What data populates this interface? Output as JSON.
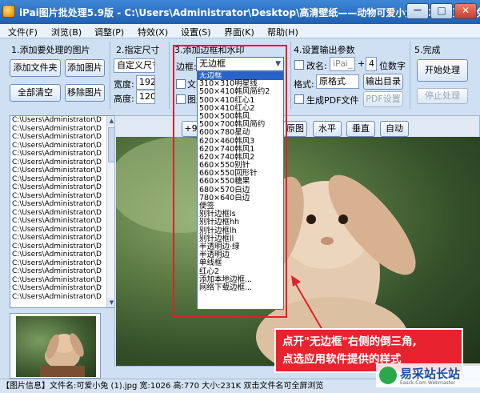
{
  "window": {
    "title": "iPai图片批处理5.9版 - C:\\Users\\Administrator\\Desktop\\高清壁纸——动物可爱小兔[40P]\\可爱小兔 (1",
    "minimize": "－",
    "maximize": "□",
    "close": "✕"
  },
  "menu": [
    "文件(F)",
    "浏览(B)",
    "调整(P)",
    "特效(X)",
    "设置(S)",
    "界面(K)",
    "帮助(H)"
  ],
  "sections": {
    "s1": "1.添加要处理的图片",
    "s2": "2.指定尺寸",
    "s3": "3.添加边框和水印",
    "s4": "4.设置输出参数",
    "s5": "5.完成"
  },
  "buttons": {
    "add_folder": "添加文件夹",
    "add_image": "添加图片",
    "clear_all": "全部清空",
    "remove_image": "移除图片",
    "output_dir": "输出目录",
    "pdf_settings": "PDF设置",
    "start": "开始处理",
    "stop": "停止处理",
    "original": "原图",
    "horizontal": "水平",
    "vertical": "垂直",
    "auto": "自动",
    "rotate_partial": "+90"
  },
  "size": {
    "preset": "自定义尺寸",
    "width_label": "宽度:",
    "width_value": "1920",
    "height_label": "高度:",
    "height_value": "1200"
  },
  "border": {
    "label": "边框:",
    "selected": "无边框",
    "text_partial": "文字",
    "image_partial": "图片",
    "options": [
      "无边框",
      "310×310明星线",
      "500×410韩风简约2",
      "500×410红心1",
      "500×410红心2",
      "500×500韩风",
      "500×700韩风简约",
      "600×780星动",
      "620×460韩风3",
      "620×740韩风1",
      "620×740韩风2",
      "660×550别针",
      "660×550回形针",
      "660×550糖果",
      "680×570白边",
      "780×640白边",
      "便签",
      "别针边框ls",
      "别针边框hh",
      "别针边框lh",
      "别针边框ll",
      "半透明边·绿",
      "半透明边",
      "单线框",
      "红心2",
      "添加本地边框...",
      "网络下载边框..."
    ]
  },
  "output": {
    "rename_label": "改名:",
    "rename_value": "iPai_",
    "plus": "+",
    "digits_value": "4",
    "digits_label": "位数字",
    "format_label": "格式:",
    "format_value": "原格式",
    "pdf_label": "生成PDF文件"
  },
  "file_list": {
    "path": "C:\\Users\\Administrator\\D",
    "count": 22
  },
  "callout": {
    "line1": "点开\"无边框\"右侧的倒三角,",
    "line2": "点选应用软件提供的样式"
  },
  "status": "【图片信息】文件名:可爱小兔 (1).jpg  宽:1026  高:770  大小:231K  双击文件名可全屏浏览",
  "watermark": {
    "name": "易采站长站",
    "sub": "Easck.Com Webmaster"
  },
  "colors": {
    "titlebar": "#2f74c8",
    "highlight": "#e0202a",
    "callout": "#e8232e",
    "selection": "#2a62c8"
  }
}
